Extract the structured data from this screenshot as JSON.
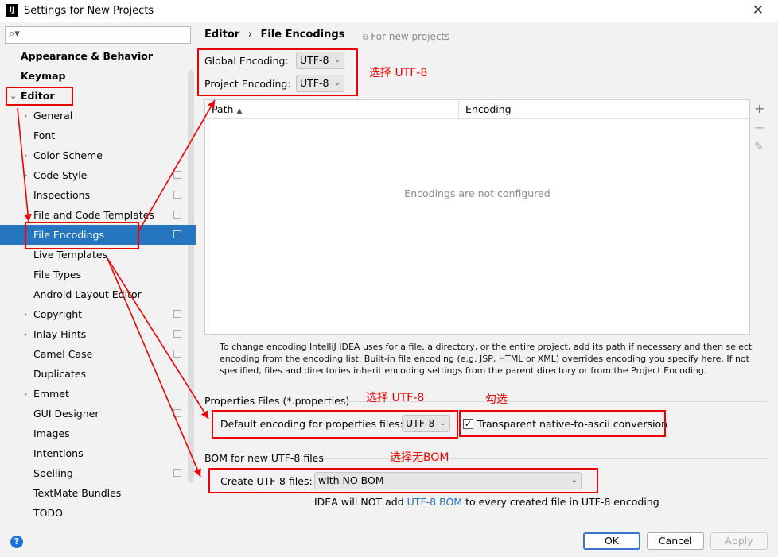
{
  "window": {
    "title": "Settings for New Projects",
    "app_icon": "IJ"
  },
  "sidebar": {
    "search_placeholder": "",
    "items": [
      {
        "label": "Appearance & Behavior"
      },
      {
        "label": "Keymap"
      },
      {
        "label": "Editor"
      },
      {
        "label": "General"
      },
      {
        "label": "Font"
      },
      {
        "label": "Color Scheme"
      },
      {
        "label": "Code Style"
      },
      {
        "label": "Inspections"
      },
      {
        "label": "File and Code Templates"
      },
      {
        "label": "File Encodings"
      },
      {
        "label": "Live Templates"
      },
      {
        "label": "File Types"
      },
      {
        "label": "Android Layout Editor"
      },
      {
        "label": "Copyright"
      },
      {
        "label": "Inlay Hints"
      },
      {
        "label": "Camel Case"
      },
      {
        "label": "Duplicates"
      },
      {
        "label": "Emmet"
      },
      {
        "label": "GUI Designer"
      },
      {
        "label": "Images"
      },
      {
        "label": "Intentions"
      },
      {
        "label": "Spelling"
      },
      {
        "label": "TextMate Bundles"
      },
      {
        "label": "TODO"
      }
    ]
  },
  "main": {
    "breadcrumb_root": "Editor",
    "breadcrumb_sep": "›",
    "breadcrumb_page": "File Encodings",
    "hint": "For new projects",
    "global_label": "Global Encoding:",
    "global_value": "UTF-8",
    "project_label": "Project Encoding:",
    "project_value": "UTF-8",
    "table": {
      "col_path": "Path",
      "sort_indicator": "▲",
      "col_encoding": "Encoding",
      "empty": "Encodings are not configured"
    },
    "note": "To change encoding IntelliJ IDEA uses for a file, a directory, or the entire project, add its path if necessary and then select encoding from the encoding list. Built-in file encoding (e.g. JSP, HTML or XML) overrides encoding you specify here. If not specified, files and directories inherit encoding settings from the parent directory or from the Project Encoding.",
    "props_section": "Properties Files (*.properties)",
    "props_label": "Default encoding for properties files:",
    "props_value": "UTF-8",
    "native_ascii_label": "Transparent native-to-ascii conversion",
    "native_ascii_checked": true,
    "bom_section": "BOM for new UTF-8 files",
    "bom_label": "Create UTF-8 files:",
    "bom_value": "with NO BOM",
    "bom_note_pre": "IDEA will NOT add",
    "bom_note_link": "UTF-8 BOM",
    "bom_note_post": "to every created file in UTF-8 encoding"
  },
  "annotations": {
    "select_utf8_1": "选择 UTF-8",
    "select_utf8_2": "选择 UTF-8",
    "check": "勾选",
    "select_no_bom": "选择无BOM",
    "color": "#e00000"
  },
  "buttons": {
    "help": "?",
    "ok": "OK",
    "cancel": "Cancel",
    "apply": "Apply"
  }
}
